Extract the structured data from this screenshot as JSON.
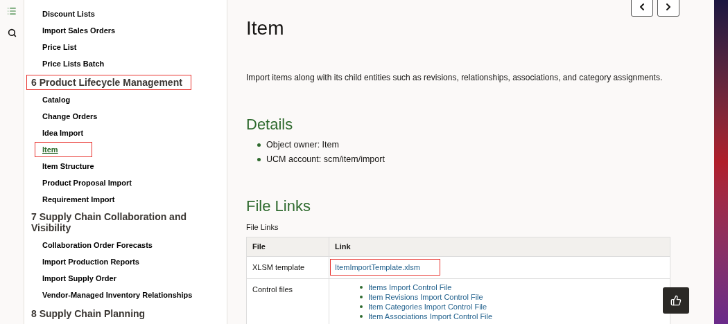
{
  "sidebar": {
    "groups": [
      {
        "items": [
          {
            "label": "Discount Lists",
            "selected": false,
            "highlighted": false
          },
          {
            "label": "Import Sales Orders",
            "selected": false,
            "highlighted": false
          },
          {
            "label": "Price List",
            "selected": false,
            "highlighted": false
          },
          {
            "label": "Price Lists Batch",
            "selected": false,
            "highlighted": false
          }
        ]
      },
      {
        "heading": {
          "text": "6 Product Lifecycle Management",
          "highlighted": true
        },
        "items": [
          {
            "label": "Catalog",
            "selected": false,
            "highlighted": false
          },
          {
            "label": "Change Orders",
            "selected": false,
            "highlighted": false
          },
          {
            "label": "Idea Import",
            "selected": false,
            "highlighted": false
          },
          {
            "label": "Item",
            "selected": true,
            "highlighted": true
          },
          {
            "label": "Item Structure",
            "selected": false,
            "highlighted": false
          },
          {
            "label": "Product Proposal Import",
            "selected": false,
            "highlighted": false
          },
          {
            "label": "Requirement Import",
            "selected": false,
            "highlighted": false
          }
        ]
      },
      {
        "heading": {
          "text": "7 Supply Chain Collaboration and Visibility",
          "highlighted": false
        },
        "items": [
          {
            "label": "Collaboration Order Forecasts",
            "selected": false,
            "highlighted": false
          },
          {
            "label": "Import Production Reports",
            "selected": false,
            "highlighted": false
          },
          {
            "label": "Import Supply Order",
            "selected": false,
            "highlighted": false
          },
          {
            "label": "Vendor-Managed Inventory Relationships",
            "selected": false,
            "highlighted": false
          }
        ]
      },
      {
        "heading": {
          "text": "8 Supply Chain Planning",
          "highlighted": false
        }
      }
    ]
  },
  "page": {
    "title": "Item",
    "description": "Import items along with its child entities such as revisions, relationships, associations, and category assignments.",
    "details": {
      "heading": "Details",
      "bullets": [
        "Object owner: Item",
        "UCM account: scm/item/import"
      ]
    },
    "file_links": {
      "heading": "File Links",
      "caption": "File Links",
      "columns": [
        "File",
        "Link"
      ],
      "rows": [
        {
          "file": "XLSM template",
          "kind": "link",
          "link": {
            "text": "ItemImportTemplate.xlsm",
            "highlighted": true
          }
        },
        {
          "file": "Control files",
          "kind": "list",
          "links": [
            "Items Import Control File",
            "Item Revisions Import Control File",
            "Item Categories Import Control File",
            "Item Associations Import Control File"
          ]
        }
      ]
    }
  }
}
